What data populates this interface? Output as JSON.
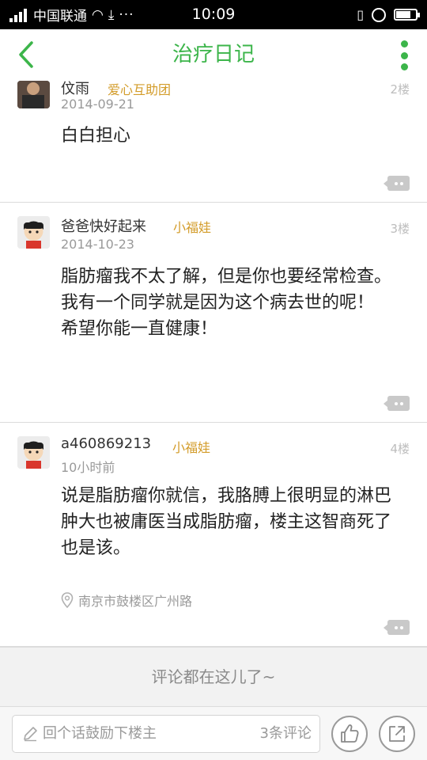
{
  "statusbar": {
    "carrier": "中国联通",
    "time": "10:09",
    "more": "···"
  },
  "nav": {
    "title": "治疗日记"
  },
  "comments": [
    {
      "name": "伩雨",
      "badge": "爱心互助团",
      "date": "2014-09-21",
      "floor": "2楼",
      "text": "白白担心"
    },
    {
      "name": "爸爸快好起来",
      "badge": "小福娃",
      "date": "2014-10-23",
      "floor": "3楼",
      "text": "脂肪瘤我不太了解，但是你也要经常检查。我有一个同学就是因为这个病去世的呢！\n希望你能一直健康！"
    },
    {
      "name": "a460869213",
      "badge": "小福娃",
      "date": "10小时前",
      "floor": "4楼",
      "text": "说是脂肪瘤你就信，我胳膊上很明显的淋巴肿大也被庸医当成脂肪瘤，楼主这智商死了也是该。",
      "location": "南京市鼓楼区广州路"
    }
  ],
  "hint": "评论都在这儿了~",
  "bottombar": {
    "input_placeholder": "回个话鼓励下楼主",
    "comment_count": "3条评论"
  },
  "colors": {
    "accent": "#3cb54a",
    "badge": "#d39c2a"
  }
}
